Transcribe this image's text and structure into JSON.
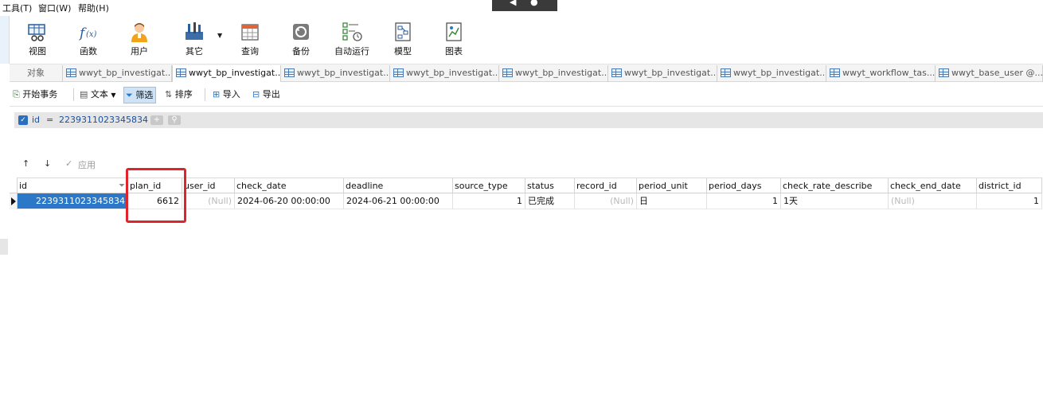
{
  "menu": {
    "tools": "工具(T)",
    "window": "窗口(W)",
    "help": "帮助(H)"
  },
  "toolbar": {
    "view": "视图",
    "function": "函数",
    "user": "用户",
    "other": "其它",
    "query": "查询",
    "backup": "备份",
    "autorun": "自动运行",
    "model": "模型",
    "chart": "图表"
  },
  "tabs": {
    "objects": "对象",
    "items": [
      "wwyt_bp_investigat...",
      "wwyt_bp_investigat...",
      "wwyt_bp_investigat...",
      "wwyt_bp_investigat...",
      "wwyt_bp_investigat...",
      "wwyt_bp_investigat...",
      "wwyt_bp_investigat...",
      "wwyt_workflow_tas...",
      "wwyt_base_user @..."
    ],
    "active_index": 1
  },
  "actions": {
    "begin_transaction": "开始事务",
    "text": "文本",
    "filter": "筛选",
    "sort": "排序",
    "import": "导入",
    "export": "导出"
  },
  "filter": {
    "field": "id",
    "operator": "=",
    "value": "2239311023345834"
  },
  "nav": {
    "apply": "应用"
  },
  "grid": {
    "columns": [
      "id",
      "plan_id",
      "user_id",
      "check_date",
      "deadline",
      "source_type",
      "status",
      "record_id",
      "period_unit",
      "period_days",
      "check_rate_describe",
      "check_end_date",
      "district_id"
    ],
    "row": {
      "id": "2239311023345834",
      "plan_id": "6612",
      "user_id": "(Null)",
      "check_date": "2024-06-20 00:00:00",
      "deadline": "2024-06-21 00:00:00",
      "source_type": "1",
      "status": "已完成",
      "record_id": "(Null)",
      "period_unit": "日",
      "period_days": "1",
      "check_rate_describe": "1天",
      "check_end_date": "(Null)",
      "district_id": "1"
    }
  },
  "colors": {
    "accent": "#2b78c9",
    "highlight": "#e0242b",
    "filter_text": "#1a4f9a"
  }
}
